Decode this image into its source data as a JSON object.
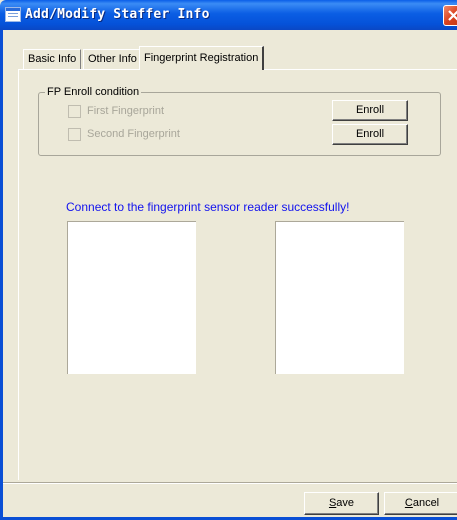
{
  "window": {
    "title": "Add/Modify Staffer Info"
  },
  "tabs": [
    {
      "label": "Basic Info"
    },
    {
      "label": "Other Info"
    },
    {
      "label": "Fingerprint Registration",
      "active": true
    }
  ],
  "enroll_group": {
    "label": "FP Enroll condition",
    "rows": [
      {
        "checkbox_label": "First Fingerprint",
        "checked": false,
        "enabled": false,
        "button_label": "Enroll"
      },
      {
        "checkbox_label": "Second Fingerprint",
        "checked": false,
        "enabled": false,
        "button_label": "Enroll"
      }
    ]
  },
  "status_message": "Connect to the fingerprint sensor reader successfully!",
  "footer": {
    "save": {
      "prefix": "",
      "accel": "S",
      "rest": "ave"
    },
    "cancel": {
      "prefix": "",
      "accel": "C",
      "rest": "ancel"
    }
  },
  "colors": {
    "titlebar": "#0552d9",
    "face": "#ece9d8",
    "status_text": "#1212ee",
    "disabled_text": "#a8a69a"
  }
}
